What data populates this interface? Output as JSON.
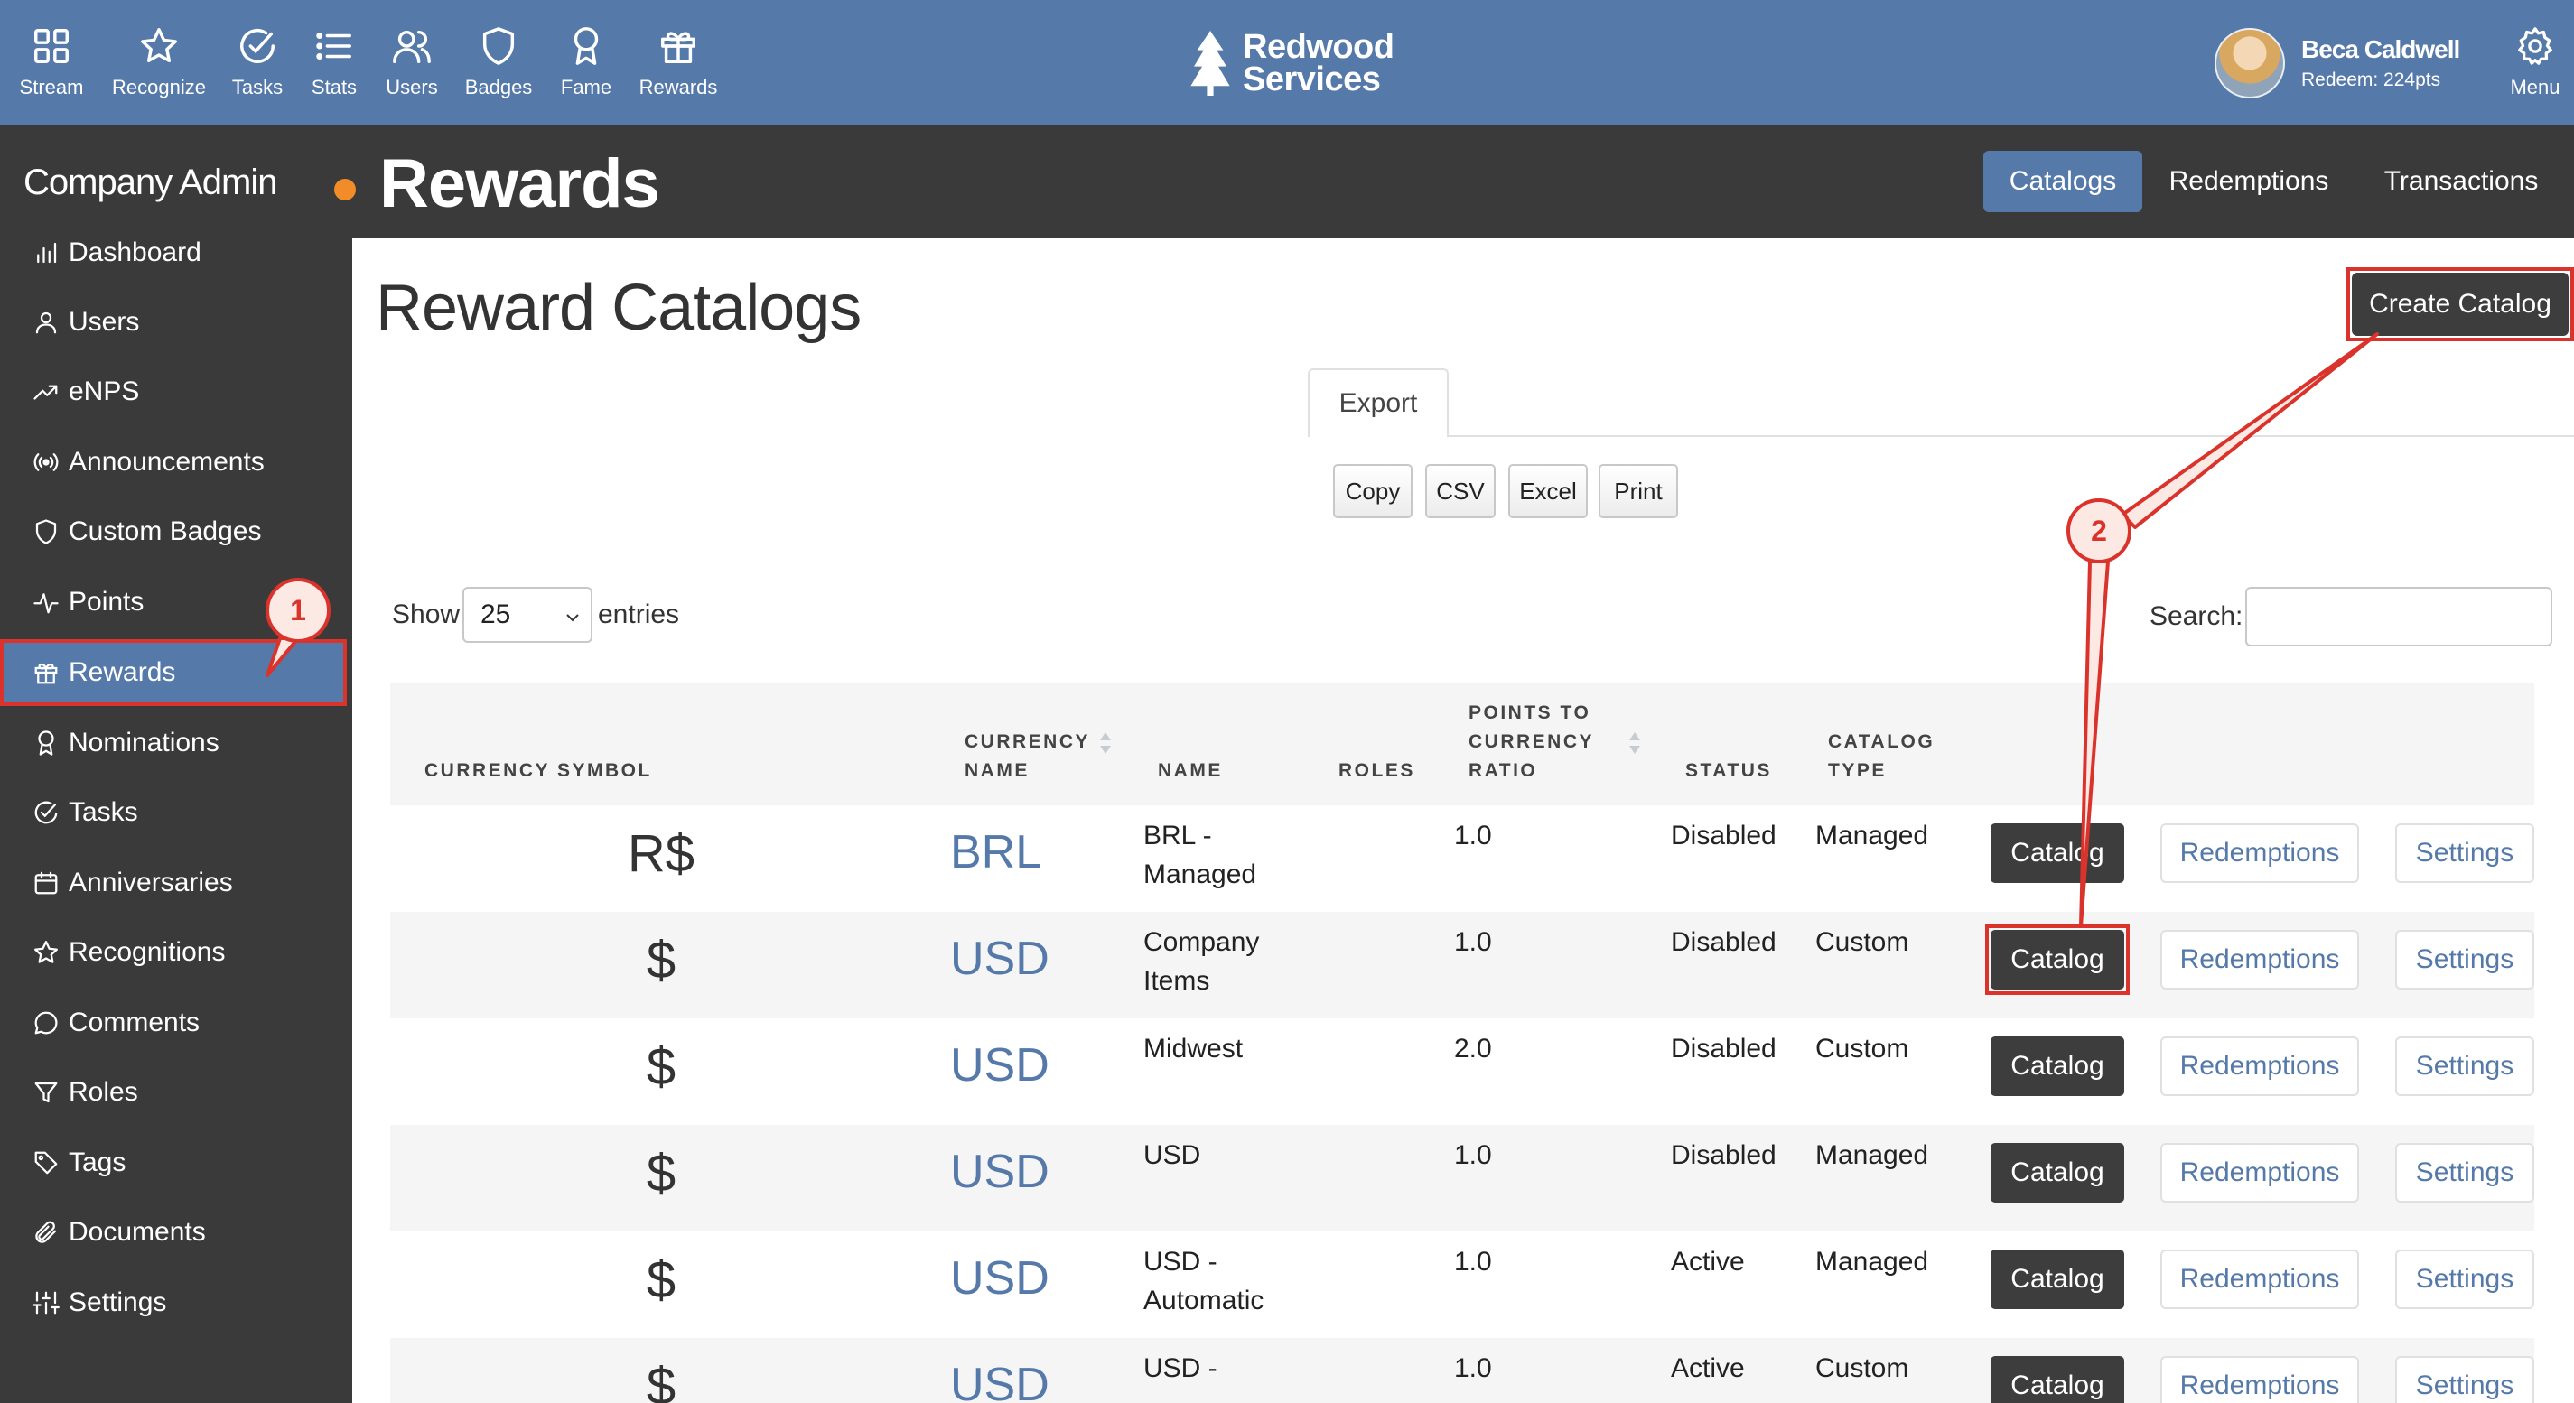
{
  "topnav": {
    "items": [
      {
        "label": "Stream",
        "icon": "grid-icon"
      },
      {
        "label": "Recognize",
        "icon": "star-icon"
      },
      {
        "label": "Tasks",
        "icon": "check-circle-icon"
      },
      {
        "label": "Stats",
        "icon": "list-icon"
      },
      {
        "label": "Users",
        "icon": "users-icon"
      },
      {
        "label": "Badges",
        "icon": "shield-icon"
      },
      {
        "label": "Fame",
        "icon": "award-icon"
      },
      {
        "label": "Rewards",
        "icon": "gift-icon"
      }
    ],
    "brand_line1": "Redwood",
    "brand_line2": "Services",
    "user_name": "Beca Caldwell",
    "user_points": "Redeem: 224pts",
    "menu_label": "Menu",
    "color": "#5579a9"
  },
  "sidebar": {
    "title": "Company Admin",
    "items": [
      {
        "label": "Dashboard",
        "icon": "bar-chart-icon"
      },
      {
        "label": "Users",
        "icon": "user-icon"
      },
      {
        "label": "eNPS",
        "icon": "trend-icon"
      },
      {
        "label": "Announcements",
        "icon": "broadcast-icon"
      },
      {
        "label": "Custom Badges",
        "icon": "shield-icon"
      },
      {
        "label": "Points",
        "icon": "pulse-icon"
      },
      {
        "label": "Rewards",
        "icon": "gift-icon"
      },
      {
        "label": "Nominations",
        "icon": "award-icon"
      },
      {
        "label": "Tasks",
        "icon": "check-circle-icon"
      },
      {
        "label": "Anniversaries",
        "icon": "calendar-icon"
      },
      {
        "label": "Recognitions",
        "icon": "star-icon"
      },
      {
        "label": "Comments",
        "icon": "comment-icon"
      },
      {
        "label": "Roles",
        "icon": "filter-icon"
      },
      {
        "label": "Tags",
        "icon": "tag-icon"
      },
      {
        "label": "Documents",
        "icon": "paperclip-icon"
      },
      {
        "label": "Settings",
        "icon": "sliders-icon"
      }
    ],
    "active": "Rewards"
  },
  "header": {
    "title": "Rewards",
    "tabs": [
      "Catalogs",
      "Redemptions",
      "Transactions"
    ],
    "active_tab": "Catalogs"
  },
  "main": {
    "title": "Reward Catalogs",
    "create_button": "Create Catalog",
    "export_tab": "Export",
    "export_buttons": [
      "Copy",
      "CSV",
      "Excel",
      "Print"
    ],
    "show_label": "Show",
    "show_value": "25",
    "entries_label": "entries",
    "search_label": "Search:",
    "columns": {
      "currency_symbol": "CURRENCY SYMBOL",
      "currency_name_1": "CURRENCY",
      "currency_name_2": "NAME",
      "name": "NAME",
      "roles": "ROLES",
      "ratio_1": "POINTS TO",
      "ratio_2": "CURRENCY",
      "ratio_3": "RATIO",
      "status": "STATUS",
      "type_1": "CATALOG",
      "type_2": "TYPE"
    },
    "rows": [
      {
        "symbol": "R$",
        "currency": "BRL",
        "name1": "BRL -",
        "name2": "Managed",
        "ratio": "1.0",
        "status": "Disabled",
        "type": "Managed"
      },
      {
        "symbol": "$",
        "currency": "USD",
        "name1": "Company",
        "name2": "Items",
        "ratio": "1.0",
        "status": "Disabled",
        "type": "Custom"
      },
      {
        "symbol": "$",
        "currency": "USD",
        "name1": "Midwest",
        "name2": "",
        "ratio": "2.0",
        "status": "Disabled",
        "type": "Custom"
      },
      {
        "symbol": "$",
        "currency": "USD",
        "name1": "USD",
        "name2": "",
        "ratio": "1.0",
        "status": "Disabled",
        "type": "Managed"
      },
      {
        "symbol": "$",
        "currency": "USD",
        "name1": "USD -",
        "name2": "Automatic",
        "ratio": "1.0",
        "status": "Active",
        "type": "Managed"
      },
      {
        "symbol": "$",
        "currency": "USD",
        "name1": "USD -",
        "name2": "",
        "ratio": "1.0",
        "status": "Active",
        "type": "Custom"
      }
    ],
    "row_buttons": {
      "catalog": "Catalog",
      "redemptions": "Redemptions",
      "settings": "Settings"
    }
  },
  "annotations": {
    "marker1": "1",
    "marker2": "2",
    "color": "#d9332c"
  }
}
